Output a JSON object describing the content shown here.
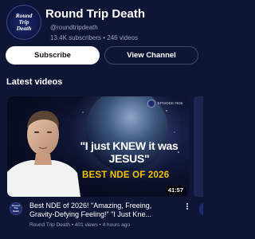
{
  "channel": {
    "avatar_text": [
      "Round",
      "Trip",
      "Death"
    ],
    "name": "Round Trip Death",
    "handle": "@roundtripdeath",
    "stats": "13.4K subscribers • 246 videos"
  },
  "actions": {
    "subscribe_label": "Subscribe",
    "view_channel_label": "View Channel"
  },
  "section": {
    "title": "Latest videos"
  },
  "video": {
    "thumbnail": {
      "episode": "EPISODE #636",
      "quote": "\"I just KNEW it was JESUS\"",
      "banner": "BEST NDE OF 2026",
      "duration": "41:57"
    },
    "title_lines": [
      "Best NDE of 2026!  \"Amazing, Freeing,",
      "Gravity-Defying Feeling!\"  \"I Just Kne..."
    ],
    "meta": "Round Trip Death • 401 views • 4 hours ago"
  },
  "colors": {
    "background": "#0f1534",
    "banner_yellow": "#f3c400",
    "subscribe_bg": "#ffffff"
  }
}
